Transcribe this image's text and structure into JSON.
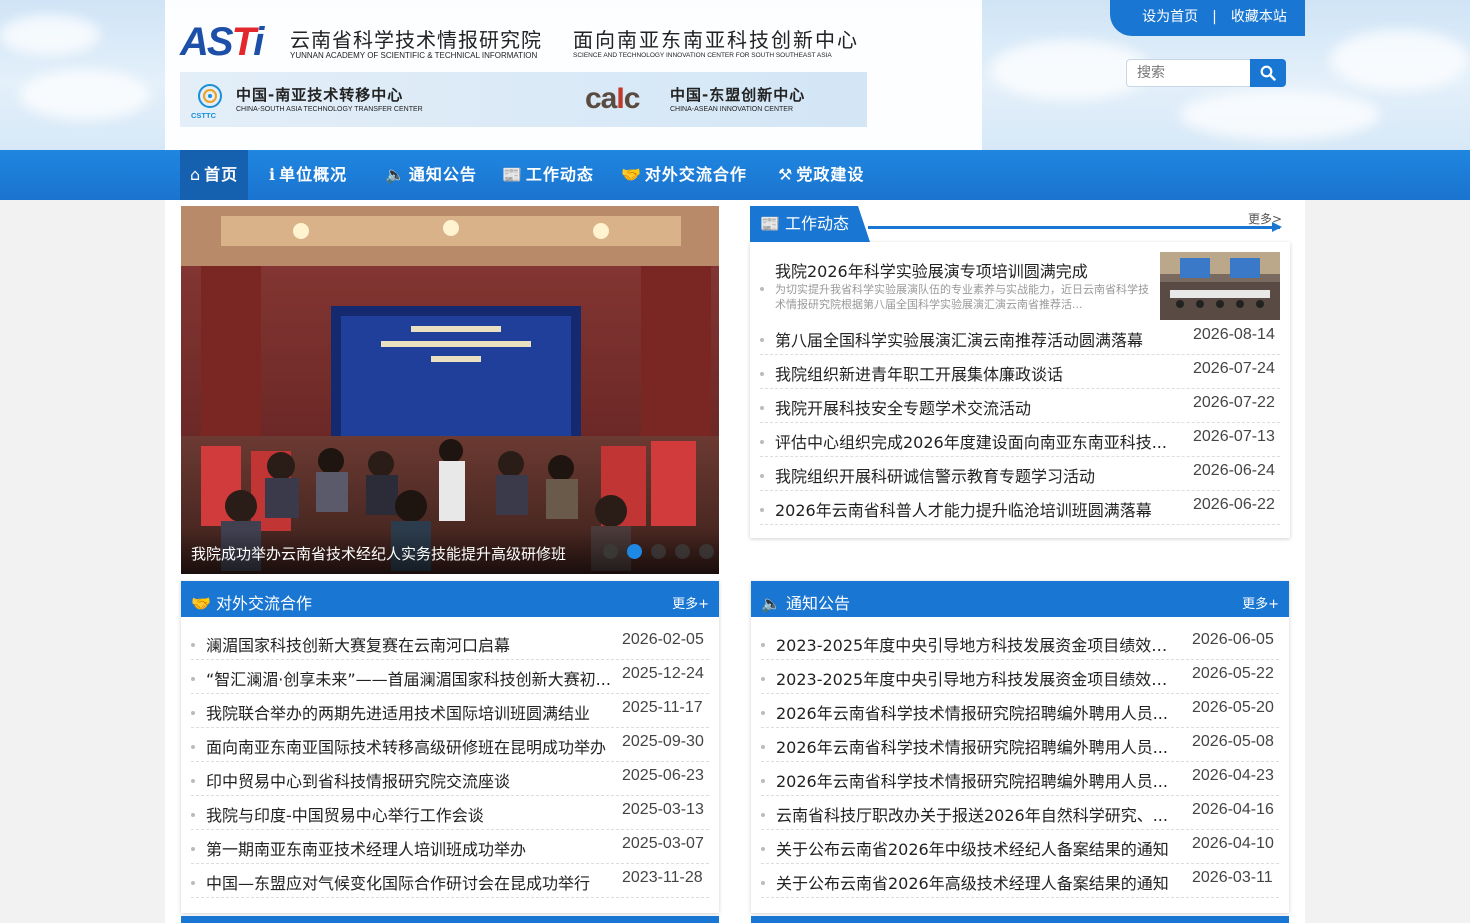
{
  "header": {
    "logo_part1": "AS",
    "logo_part2": "T",
    "logo_part3": "i",
    "institute_cn": "云南省科学技术情报研究院",
    "institute_en": "YUNNAN ACADEMY OF SCIENTIFIC & TECHNICAL INFORMATION",
    "center_cn": "面向南亚东南亚科技创新中心",
    "center_en": "SCIENCE AND TECHNOLOGY INNOVATION CENTER FOR SOUTH SOUTHEAST ASIA",
    "cstt_logo_text": "CSTTC",
    "cstt_cn": "中国-南亚技术转移中心",
    "cstt_en": "CHINA-SOUTH ASIA TECHNOLOGY TRANSFER CENTER",
    "caic_logo_a": "ca",
    "caic_logo_b": "I",
    "caic_logo_c": "c",
    "caic_cn": "中国-东盟创新中心",
    "caic_en": "CHINA-ASEAN INNOVATION CENTER"
  },
  "top_links": {
    "set_home": "设为首页",
    "separator": "|",
    "bookmark": "收藏本站"
  },
  "search": {
    "placeholder": "搜索"
  },
  "nav": [
    {
      "icon": "⌂",
      "label": "首页"
    },
    {
      "icon": "ℹ",
      "label": "单位概况"
    },
    {
      "icon": "🔈",
      "label": "通知公告"
    },
    {
      "icon": "📰",
      "label": "工作动态"
    },
    {
      "icon": "🤝",
      "label": "对外交流合作"
    },
    {
      "icon": "⚒",
      "label": "党政建设"
    }
  ],
  "slider": {
    "caption": "我院成功举办云南省技术经纪人实务技能提升高级研修班",
    "slide_count": 5,
    "active_index": 1
  },
  "work_news": {
    "title": "工作动态",
    "more": "更多>",
    "featured": {
      "title": "我院2026年科学实验展演专项培训圆满完成",
      "desc": "为切实提升我省科学实验展演队伍的专业素养与实战能力，近日云南省科学技术情报研究院根据第八届全国科学实验展演汇演云南省推荐活..."
    },
    "items": [
      {
        "title": "第八届全国科学实验展演汇演云南推荐活动圆满落幕",
        "date": "2026-08-14"
      },
      {
        "title": "我院组织新进青年职工开展集体廉政谈话",
        "date": "2026-07-24"
      },
      {
        "title": "我院开展科技安全专题学术交流活动",
        "date": "2026-07-22"
      },
      {
        "title": "评估中心组织完成2026年度建设面向南亚东南亚科技...",
        "date": "2026-07-13"
      },
      {
        "title": "我院组织开展科研诚信警示教育专题学习活动",
        "date": "2026-06-24"
      },
      {
        "title": "2026年云南省科普人才能力提升临沧培训班圆满落幕",
        "date": "2026-06-22"
      }
    ]
  },
  "exchange": {
    "title": "对外交流合作",
    "more": "更多+",
    "items": [
      {
        "title": "澜湄国家科技创新大赛复赛在云南河口启幕",
        "date": "2026-02-05"
      },
      {
        "title": "“智汇澜湄·创享未来”——首届澜湄国家科技创新大赛初...",
        "date": "2025-12-24"
      },
      {
        "title": "我院联合举办的两期先进适用技术国际培训班圆满结业",
        "date": "2025-11-17"
      },
      {
        "title": "面向南亚东南亚国际技术转移高级研修班在昆明成功举办",
        "date": "2025-09-30"
      },
      {
        "title": "印中贸易中心到省科技情报研究院交流座谈",
        "date": "2025-06-23"
      },
      {
        "title": "我院与印度-中国贸易中心举行工作会谈",
        "date": "2025-03-13"
      },
      {
        "title": "第一期南亚东南亚技术经理人培训班成功举办",
        "date": "2025-03-07"
      },
      {
        "title": "中国—东盟应对气候变化国际合作研讨会在昆成功举行",
        "date": "2023-11-28"
      }
    ]
  },
  "notices": {
    "title": "通知公告",
    "more": "更多+",
    "items": [
      {
        "title": "2023-2025年度中央引导地方科技发展资金项目绩效评...",
        "date": "2026-06-05"
      },
      {
        "title": "2023-2025年度中央引导地方科技发展资金项目绩效评...",
        "date": "2026-05-22"
      },
      {
        "title": "2026年云南省科学技术情报研究院招聘编外聘用人员...",
        "date": "2026-05-20"
      },
      {
        "title": "2026年云南省科学技术情报研究院招聘编外聘用人员...",
        "date": "2026-05-08"
      },
      {
        "title": "2026年云南省科学技术情报研究院招聘编外聘用人员...",
        "date": "2026-04-23"
      },
      {
        "title": "云南省科技厅职改办关于报送2026年自然科学研究、...",
        "date": "2026-04-16"
      },
      {
        "title": "关于公布云南省2026年中级技术经纪人备案结果的通知",
        "date": "2026-04-10"
      },
      {
        "title": "关于公布云南省2026年高级技术经理人备案结果的通知",
        "date": "2026-03-11"
      }
    ]
  },
  "colors": {
    "primary": "#1976d2",
    "nav_active": "#1660b0",
    "dot_active": "#1e88e5"
  }
}
